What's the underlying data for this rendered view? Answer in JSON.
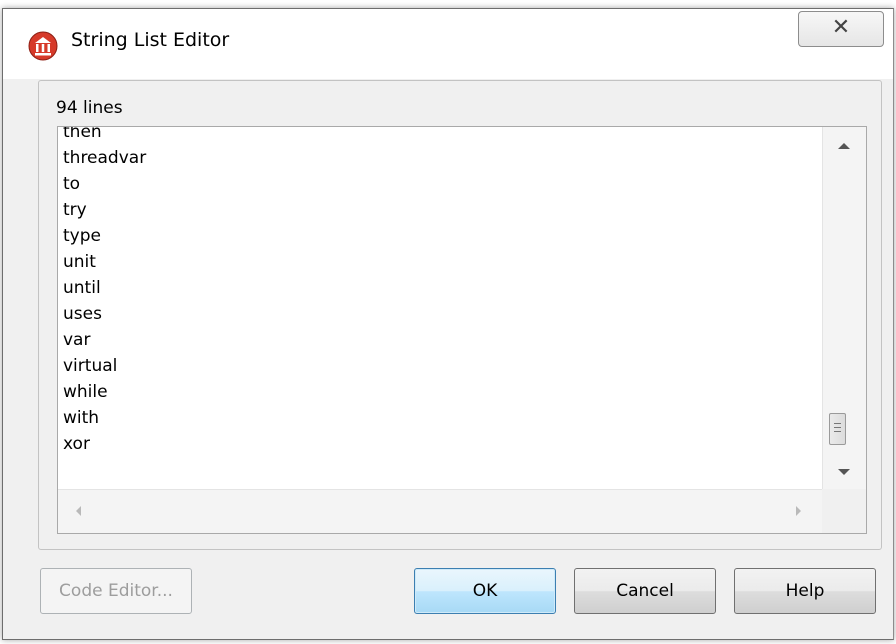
{
  "window": {
    "title": "String List Editor",
    "app_icon": "app-icon",
    "close_glyph": "✕"
  },
  "editor": {
    "line_count_label": "94 lines",
    "visible_lines": [
      "then",
      "threadvar",
      "to",
      "try",
      "type",
      "unit",
      "until",
      "uses",
      "var",
      "virtual",
      "while",
      "with",
      "xor"
    ],
    "vertical_scroll_position": 0.93
  },
  "buttons": {
    "code_editor": "Code Editor...",
    "ok": "OK",
    "cancel": "Cancel",
    "help": "Help"
  },
  "colors": {
    "app_icon": "#d63a2a",
    "default_button_border": "#3c7fb1"
  }
}
